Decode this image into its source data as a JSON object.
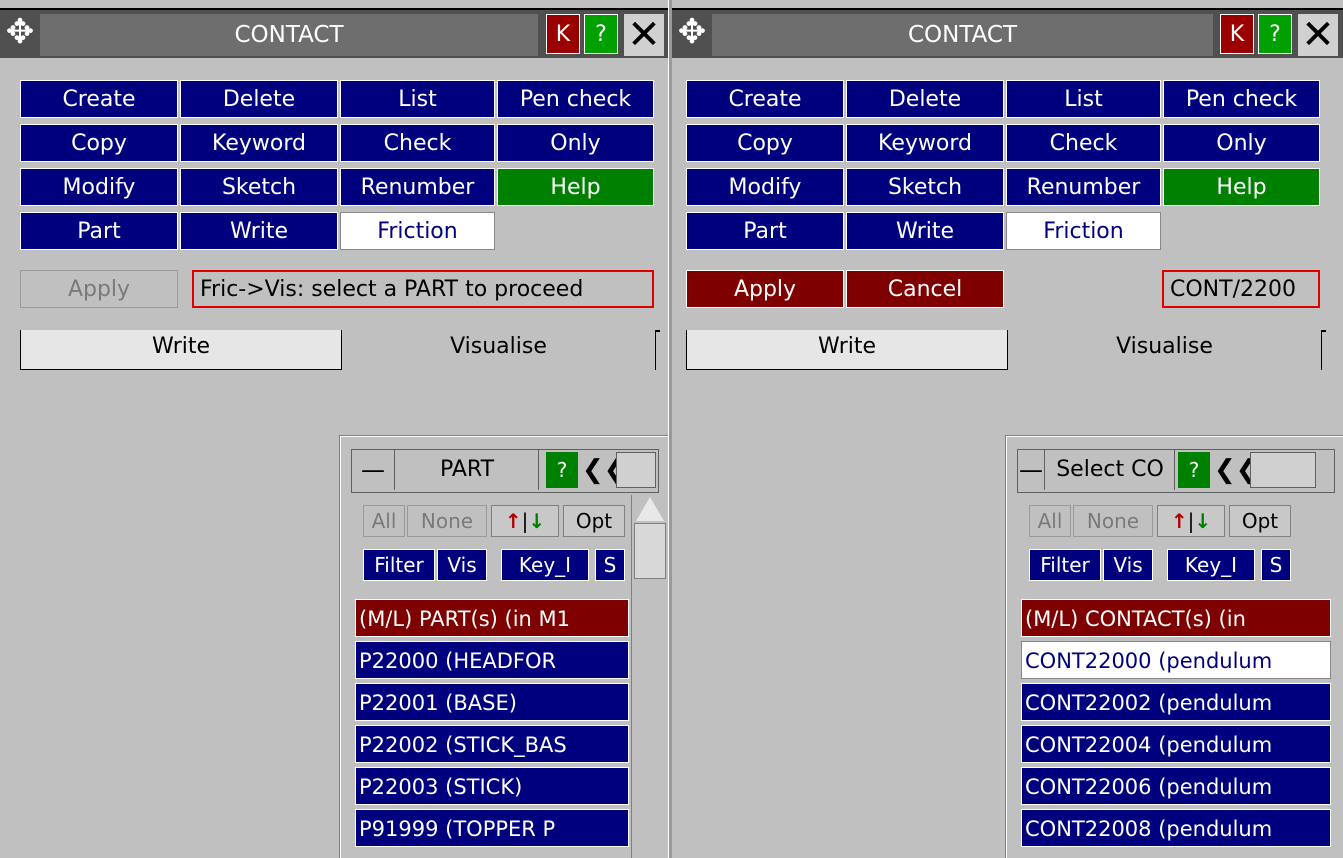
{
  "left": {
    "title": "CONTACT",
    "k": "K",
    "help_q": "?",
    "close": "✕",
    "move": "✥",
    "buttons": {
      "create": "Create",
      "delete": "Delete",
      "list": "List",
      "pen_check": "Pen check",
      "copy": "Copy",
      "keyword": "Keyword",
      "check": "Check",
      "only": "Only",
      "modify": "Modify",
      "sketch": "Sketch",
      "renumber": "Renumber",
      "help": "Help",
      "part": "Part",
      "write": "Write",
      "friction": "Friction"
    },
    "apply": "Apply",
    "message": "Fric->Vis: select a PART to proceed",
    "tabs": {
      "write": "Write",
      "visualise": "Visualise"
    },
    "selector": {
      "dash": "—",
      "title": "PART",
      "q": "?",
      "chev": "❮❮",
      "all": "All",
      "none": "None",
      "up": "↑",
      "bar": "|",
      "down": "↓",
      "opt": "Opt",
      "filter": "Filter",
      "vis": "Vis",
      "key": "Key_I",
      "s": "S",
      "rows": [
        "(M/L) PART(s) (in M1",
        "P22000 (HEADFOR",
        "P22001 (BASE)",
        "P22002 (STICK_BAS",
        "P22003 (STICK)",
        "P91999 (TOPPER P"
      ]
    }
  },
  "right": {
    "title": "CONTACT",
    "k": "K",
    "help_q": "?",
    "close": "✕",
    "move": "✥",
    "buttons": {
      "create": "Create",
      "delete": "Delete",
      "list": "List",
      "pen_check": "Pen check",
      "copy": "Copy",
      "keyword": "Keyword",
      "check": "Check",
      "only": "Only",
      "modify": "Modify",
      "sketch": "Sketch",
      "renumber": "Renumber",
      "help": "Help",
      "part": "Part",
      "write": "Write",
      "friction": "Friction"
    },
    "apply": "Apply",
    "cancel": "Cancel",
    "message": "CONT/2200",
    "tabs": {
      "write": "Write",
      "visualise": "Visualise"
    },
    "selector": {
      "dash": "—",
      "title": "Select CO",
      "q": "?",
      "chev": "❮❮",
      "all": "All",
      "none": "None",
      "up": "↑",
      "bar": "|",
      "down": "↓",
      "opt": "Opt",
      "filter": "Filter",
      "vis": "Vis",
      "key": "Key_I",
      "s": "S",
      "rows": [
        "(M/L) CONTACT(s) (in",
        "CONT22000 (pendulum",
        "CONT22002 (pendulum",
        "CONT22004 (pendulum",
        "CONT22006 (pendulum",
        "CONT22008 (pendulum"
      ]
    }
  }
}
